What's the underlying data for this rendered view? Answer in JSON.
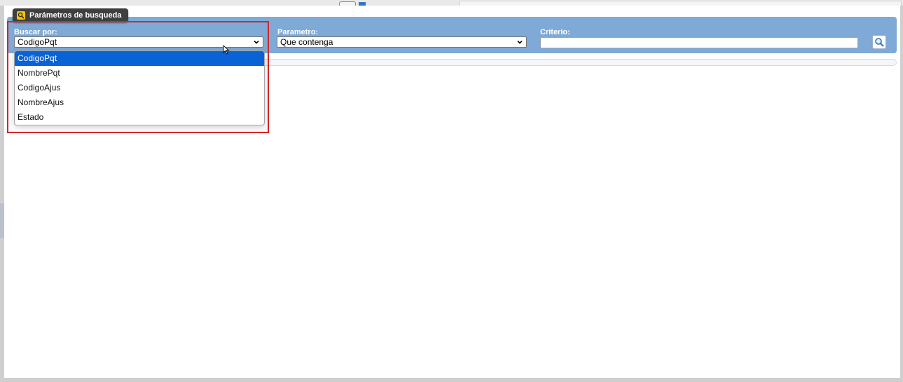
{
  "search_panel": {
    "tab_title": "Parámetros de busqueda",
    "buscar_por": {
      "label": "Buscar por:",
      "selected": "CodigoPqt",
      "options": [
        "CodigoPqt",
        "NombrePqt",
        "CodigoAjus",
        "NombreAjus",
        "Estado"
      ],
      "highlighted_option": "CodigoPqt"
    },
    "parametro": {
      "label": "Parametro:",
      "selected": "Que contenga"
    },
    "criterio": {
      "label": "Criterio:",
      "value": ""
    },
    "search_button_icon": "magnifier-icon"
  },
  "colors": {
    "panel": "#7fa9d6",
    "tab": "#3f3f3f",
    "selected_option": "#0a63d6",
    "annotation": "#d32626"
  }
}
